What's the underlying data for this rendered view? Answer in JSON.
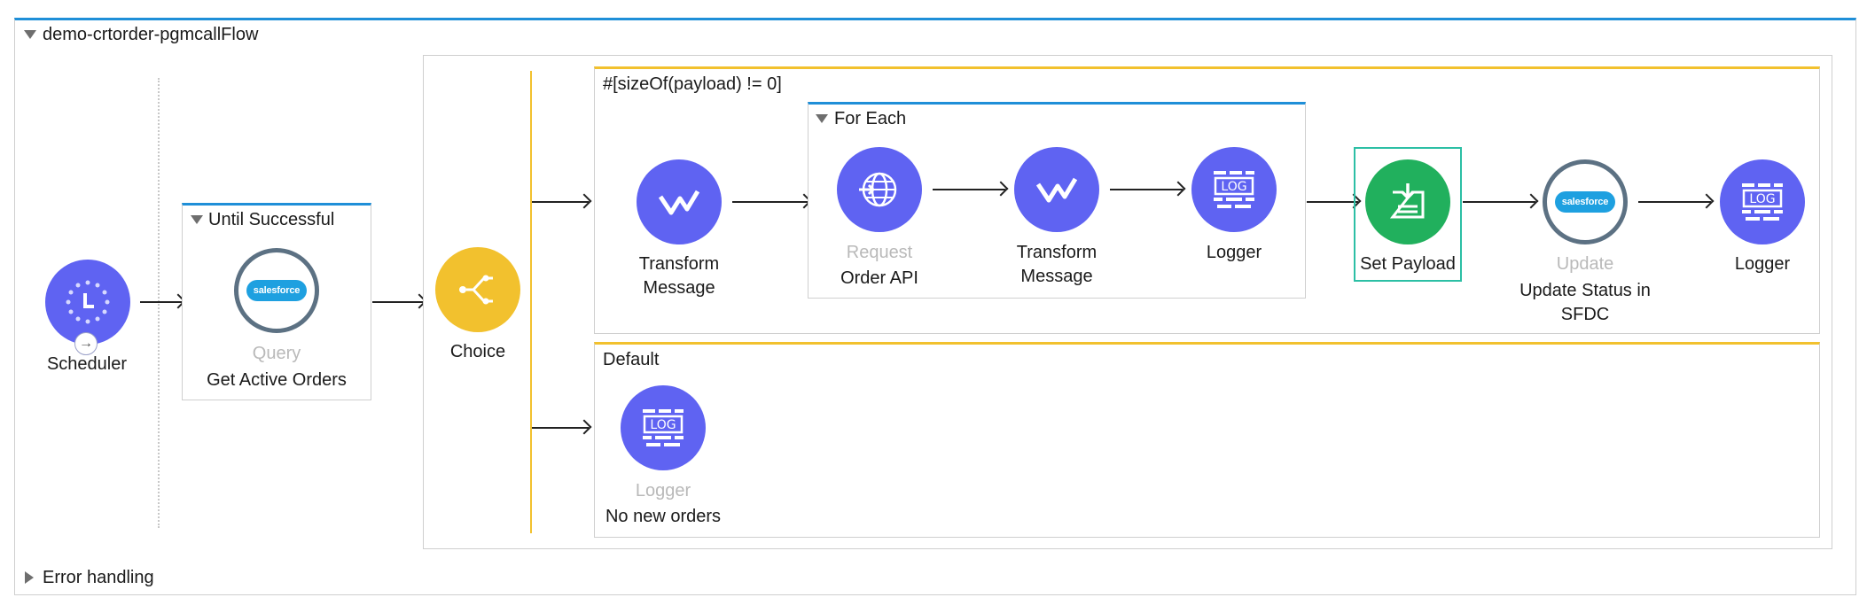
{
  "flow": {
    "name": "demo-crtorder-pgmcallFlow",
    "error_handling": "Error handling"
  },
  "scheduler": {
    "label": "Scheduler"
  },
  "until_successful": {
    "title": "Until Successful",
    "query": {
      "type": "Query",
      "label": "Get Active Orders"
    }
  },
  "choice": {
    "label": "Choice",
    "route1": {
      "condition": "#[sizeOf(payload) != 0]",
      "transform1": {
        "line1": "Transform",
        "line2": "Message"
      },
      "for_each": {
        "title": "For Each",
        "request": {
          "type": "Request",
          "label": "Order API"
        },
        "transform2": {
          "line1": "Transform",
          "line2": "Message"
        },
        "logger": {
          "label": "Logger"
        }
      },
      "set_payload": {
        "label": "Set Payload"
      },
      "update": {
        "type": "Update",
        "line1": "Update Status in",
        "line2": "SFDC"
      },
      "logger": {
        "label": "Logger"
      }
    },
    "default": {
      "title": "Default",
      "logger": {
        "type": "Logger",
        "label": "No new orders"
      }
    }
  },
  "icons": {
    "log_text": "LOG",
    "salesforce_text": "salesforce"
  },
  "colors": {
    "flow_accent": "#1f8fd8",
    "choice_yellow": "#f2c12e",
    "component_purple": "#5f63f2",
    "set_payload_green": "#21b05d",
    "salesforce_ring": "#5c7183",
    "selection_teal": "#2cbfa5"
  }
}
